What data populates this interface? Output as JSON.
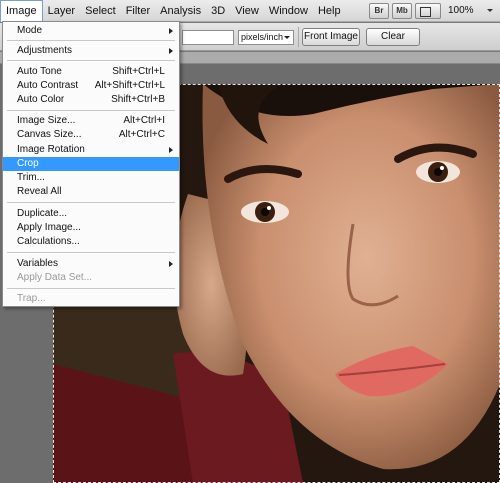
{
  "menubar": {
    "items": [
      "Image",
      "Layer",
      "Select",
      "Filter",
      "Analysis",
      "3D",
      "View",
      "Window",
      "Help"
    ],
    "active": "Image",
    "app_buttons": [
      "Br",
      "Mb"
    ],
    "zoom": "100%"
  },
  "options": {
    "units": "pixels/inch",
    "front_image": "Front Image",
    "clear": "Clear"
  },
  "image_menu": {
    "items": [
      {
        "label": "Mode",
        "shortcut": "",
        "submenu": true
      },
      {
        "label": "Adjustments",
        "shortcut": "",
        "submenu": true
      },
      {
        "label": "Auto Tone",
        "shortcut": "Shift+Ctrl+L"
      },
      {
        "label": "Auto Contrast",
        "shortcut": "Alt+Shift+Ctrl+L"
      },
      {
        "label": "Auto Color",
        "shortcut": "Shift+Ctrl+B"
      },
      {
        "label": "Image Size...",
        "shortcut": "Alt+Ctrl+I"
      },
      {
        "label": "Canvas Size...",
        "shortcut": "Alt+Ctrl+C"
      },
      {
        "label": "Image Rotation",
        "shortcut": "",
        "submenu": true
      },
      {
        "label": "Crop",
        "shortcut": "",
        "highlighted": true
      },
      {
        "label": "Trim...",
        "shortcut": ""
      },
      {
        "label": "Reveal All",
        "shortcut": ""
      },
      {
        "label": "Duplicate...",
        "shortcut": ""
      },
      {
        "label": "Apply Image...",
        "shortcut": ""
      },
      {
        "label": "Calculations...",
        "shortcut": ""
      },
      {
        "label": "Variables",
        "shortcut": "",
        "submenu": true
      },
      {
        "label": "Apply Data Set...",
        "shortcut": "",
        "disabled": true
      },
      {
        "label": "Trap...",
        "shortcut": "",
        "disabled": true
      }
    ]
  }
}
